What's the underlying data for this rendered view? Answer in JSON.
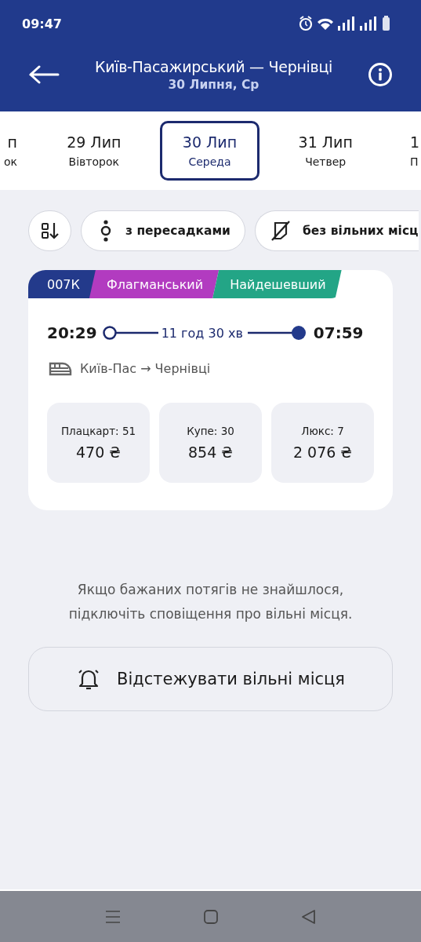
{
  "status_bar": {
    "time": "09:47"
  },
  "header": {
    "title": "Київ-Пасажирський — Чернівці",
    "subtitle": "30 Липня, Ср"
  },
  "dates": [
    {
      "day": "п",
      "weekday": "ок",
      "selected": false,
      "kind": "edge-left"
    },
    {
      "day": "29 Лип",
      "weekday": "Вівторок",
      "selected": false,
      "kind": "full"
    },
    {
      "day": "30 Лип",
      "weekday": "Середа",
      "selected": true,
      "kind": "full"
    },
    {
      "day": "31 Лип",
      "weekday": "Четвер",
      "selected": false,
      "kind": "full"
    },
    {
      "day": "1",
      "weekday": "П",
      "selected": false,
      "kind": "edge-right"
    }
  ],
  "filters": [
    {
      "kind": "sort"
    },
    {
      "kind": "transfers",
      "label": "з пересадками"
    },
    {
      "kind": "no-seats",
      "label": "без вільних місц"
    }
  ],
  "trains": [
    {
      "tags": [
        {
          "label": "007К",
          "color": "#233a8b"
        },
        {
          "label": "Флагманський",
          "color": "#b23bc0"
        },
        {
          "label": "Найдешевший",
          "color": "#23a586"
        }
      ],
      "departure": "20:29",
      "duration": "11 год 30 хв",
      "arrival": "07:59",
      "route": "Київ-Пас → Чернівці",
      "classes": [
        {
          "label": "Плацкарт: 51",
          "price": "470 ₴"
        },
        {
          "label": "Купе: 30",
          "price": "854 ₴"
        },
        {
          "label": "Люкс: 7",
          "price": "2 076 ₴"
        }
      ]
    }
  ],
  "notice": "Якщо бажаних потягів не знайшлося, підключіть сповіщення про вільні місця.",
  "track_button": {
    "label": "Відстежувати вільні місця"
  }
}
